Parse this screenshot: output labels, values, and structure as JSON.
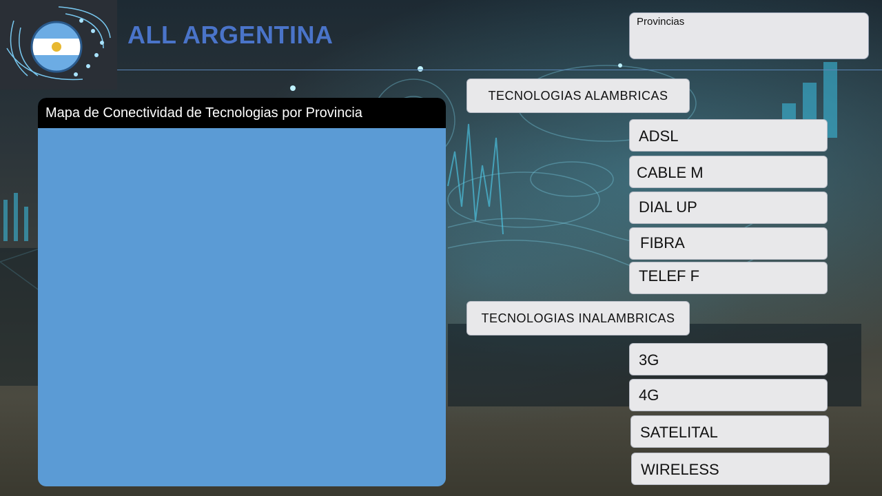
{
  "header": {
    "app_title": "ALL ARGENTINA",
    "logo_icon": "argentina-globe-circuit-logo",
    "accent_color": "#4a74c9"
  },
  "provinces_select": {
    "label": "Provincias"
  },
  "map": {
    "title": "Mapa de Conectividad de Tecnologias por Provincia",
    "fill_color": "#5b9bd5"
  },
  "wired": {
    "label": "TECNOLOGIAS  ALAMBRICAS",
    "items": [
      "ADSL",
      "CABLE M",
      "DIAL UP",
      "FIBRA",
      "TELEF F"
    ]
  },
  "wireless": {
    "label": "TECNOLOGIAS  INALAMBRICAS",
    "items": [
      "3G",
      "4G",
      "SATELITAL",
      "WIRELESS"
    ]
  }
}
